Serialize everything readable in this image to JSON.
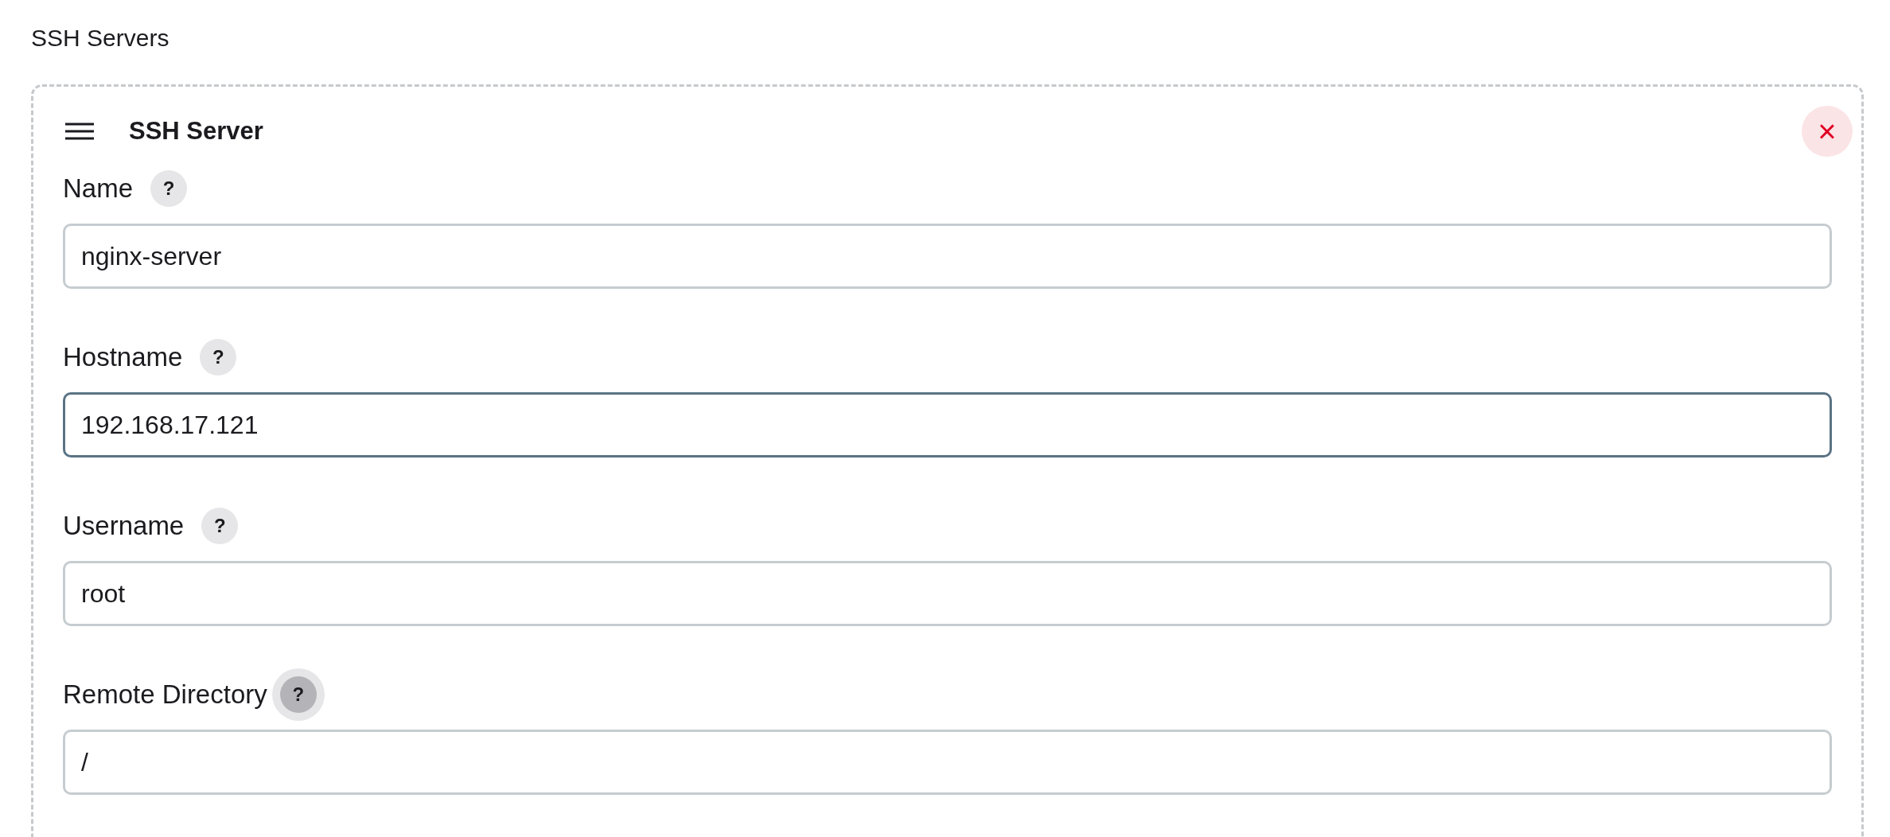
{
  "section_title": "SSH Servers",
  "card": {
    "title": "SSH Server",
    "close_glyph": "×",
    "fields": [
      {
        "label": "Name",
        "help": "?",
        "help_hovered": false,
        "value": "nginx-server",
        "focused": false
      },
      {
        "label": "Hostname",
        "help": "?",
        "help_hovered": false,
        "value": "192.168.17.121",
        "focused": true
      },
      {
        "label": "Username",
        "help": "?",
        "help_hovered": false,
        "value": "root",
        "focused": false
      },
      {
        "label": "Remote Directory",
        "help": "?",
        "help_hovered": true,
        "value": "/",
        "focused": false
      }
    ]
  }
}
